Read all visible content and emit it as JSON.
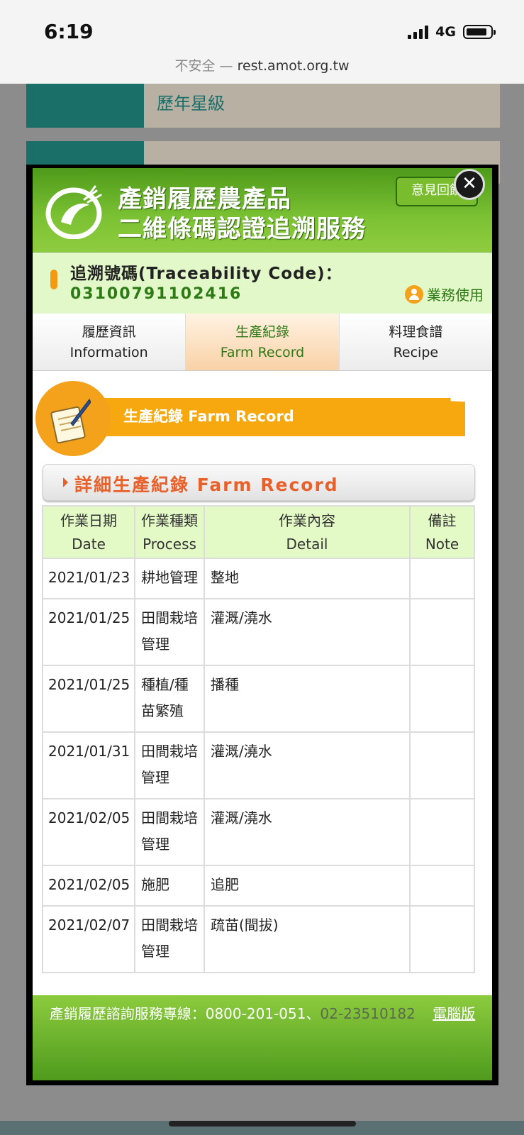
{
  "status_bar": {
    "time": "6:19",
    "network": "4G"
  },
  "browser": {
    "insecure_label": "不安全 —",
    "url": "rest.amot.org.tw"
  },
  "background_page": {
    "row1_text": "歷年星級",
    "row2_text": ""
  },
  "modal": {
    "close_label": "✕",
    "header": {
      "title_line1": "產銷履歷農產品",
      "title_line2": "二維條碼認證追溯服務",
      "feedback_button": "意見回饋"
    },
    "traceability": {
      "label": "追溯號碼(Traceability Code)：",
      "code": "03100791102416",
      "business_link": "業務使用"
    },
    "tabs": [
      {
        "zh": "履歷資訊",
        "en": "Information",
        "active": false
      },
      {
        "zh": "生產紀錄",
        "en": "Farm Record",
        "active": true
      },
      {
        "zh": "料理食譜",
        "en": "Recipe",
        "active": false
      }
    ],
    "section_banner": "生產紀錄 Farm Record",
    "subsection_title": "詳細生產紀錄 Farm Record",
    "table": {
      "headers": [
        {
          "zh": "作業日期",
          "en": "Date"
        },
        {
          "zh": "作業種類",
          "en": "Process"
        },
        {
          "zh": "作業內容",
          "en": "Detail"
        },
        {
          "zh": "備註",
          "en": "Note"
        }
      ],
      "rows": [
        {
          "date": "2021/01/23",
          "process": "耕地管理",
          "detail": "整地",
          "note": ""
        },
        {
          "date": "2021/01/25",
          "process": "田間栽培管理",
          "detail": "灌溉/澆水",
          "note": ""
        },
        {
          "date": "2021/01/25",
          "process": "種植/種苗繁殖",
          "detail": "播種",
          "note": ""
        },
        {
          "date": "2021/01/31",
          "process": "田間栽培管理",
          "detail": "灌溉/澆水",
          "note": ""
        },
        {
          "date": "2021/02/05",
          "process": "田間栽培管理",
          "detail": "灌溉/澆水",
          "note": ""
        },
        {
          "date": "2021/02/05",
          "process": "施肥",
          "detail": "追肥",
          "note": ""
        },
        {
          "date": "2021/02/07",
          "process": "田間栽培管理",
          "detail": "疏苗(間拔)",
          "note": ""
        }
      ]
    },
    "footer": {
      "hotline_label": "產銷履歷諮詢服務專線：0800-201-051、",
      "hotline_2": "02-23510182",
      "desktop_link": "電腦版"
    }
  },
  "colors": {
    "brand_green": "#7cc234",
    "accent_orange": "#f6a80e",
    "title_red": "#e8612b",
    "text_green": "#2e7a16"
  }
}
